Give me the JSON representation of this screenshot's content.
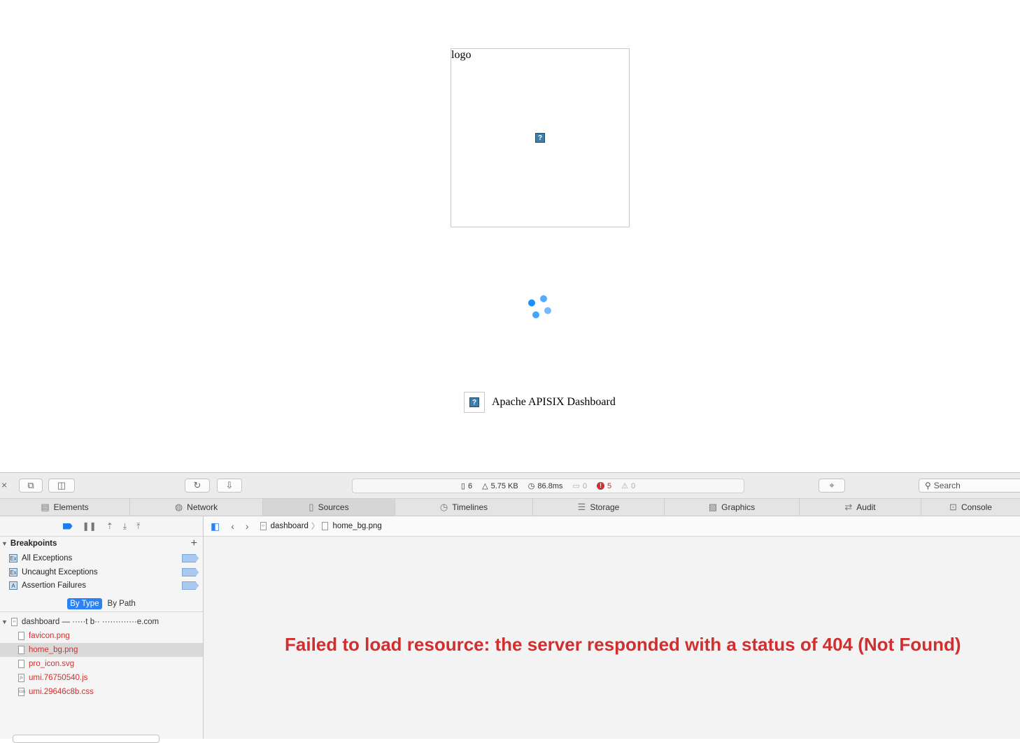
{
  "page": {
    "logo_alt": "logo",
    "brand_title": "Apache APISIX Dashboard",
    "broken_image_glyph": "?"
  },
  "devtools": {
    "toolbar": {
      "close_glyph": "×",
      "resources_count": "6",
      "resources_size": "5.75 KB",
      "load_time": "86.8ms",
      "logs_count": "0",
      "errors_count": "5",
      "warnings_count": "0",
      "search_placeholder": "Search"
    },
    "tabs": [
      {
        "label": "Elements",
        "icon": "elements-icon"
      },
      {
        "label": "Network",
        "icon": "network-icon"
      },
      {
        "label": "Sources",
        "icon": "sources-icon"
      },
      {
        "label": "Timelines",
        "icon": "timelines-icon"
      },
      {
        "label": "Storage",
        "icon": "storage-icon"
      },
      {
        "label": "Graphics",
        "icon": "graphics-icon"
      },
      {
        "label": "Audit",
        "icon": "audit-icon"
      },
      {
        "label": "Console",
        "icon": "console-icon"
      }
    ],
    "active_tab": "Sources",
    "sidebar": {
      "breakpoints_title": "Breakpoints",
      "breakpoints": [
        {
          "icon_text": "Ex",
          "label": "All Exceptions"
        },
        {
          "icon_text": "Ex",
          "label": "Uncaught Exceptions"
        },
        {
          "icon_text": "A",
          "label": "Assertion Failures"
        }
      ],
      "group_by": {
        "by_type": "By Type",
        "by_path": "By Path"
      },
      "resource_root": "dashboard — ·····t b·· ·············e.com",
      "files": [
        {
          "name": "favicon.png",
          "icon_text": "",
          "error": true
        },
        {
          "name": "home_bg.png",
          "icon_text": "",
          "error": true
        },
        {
          "name": "pro_icon.svg",
          "icon_text": "",
          "error": true
        },
        {
          "name": "umi.76750540.js",
          "icon_text": "js",
          "error": true
        },
        {
          "name": "umi.29646c8b.css",
          "icon_text": "css",
          "error": true
        }
      ],
      "selected_file": "home_bg.png"
    },
    "content": {
      "breadcrumb_root": "dashboard",
      "breadcrumb_file": "home_bg.png",
      "error_message": "Failed to load resource: the server responded with a status of 404 (Not Found)"
    },
    "colors": {
      "error_red": "#d12f2f",
      "accent_blue": "#2b82f6",
      "spinner_blue": "#1890ff"
    }
  }
}
